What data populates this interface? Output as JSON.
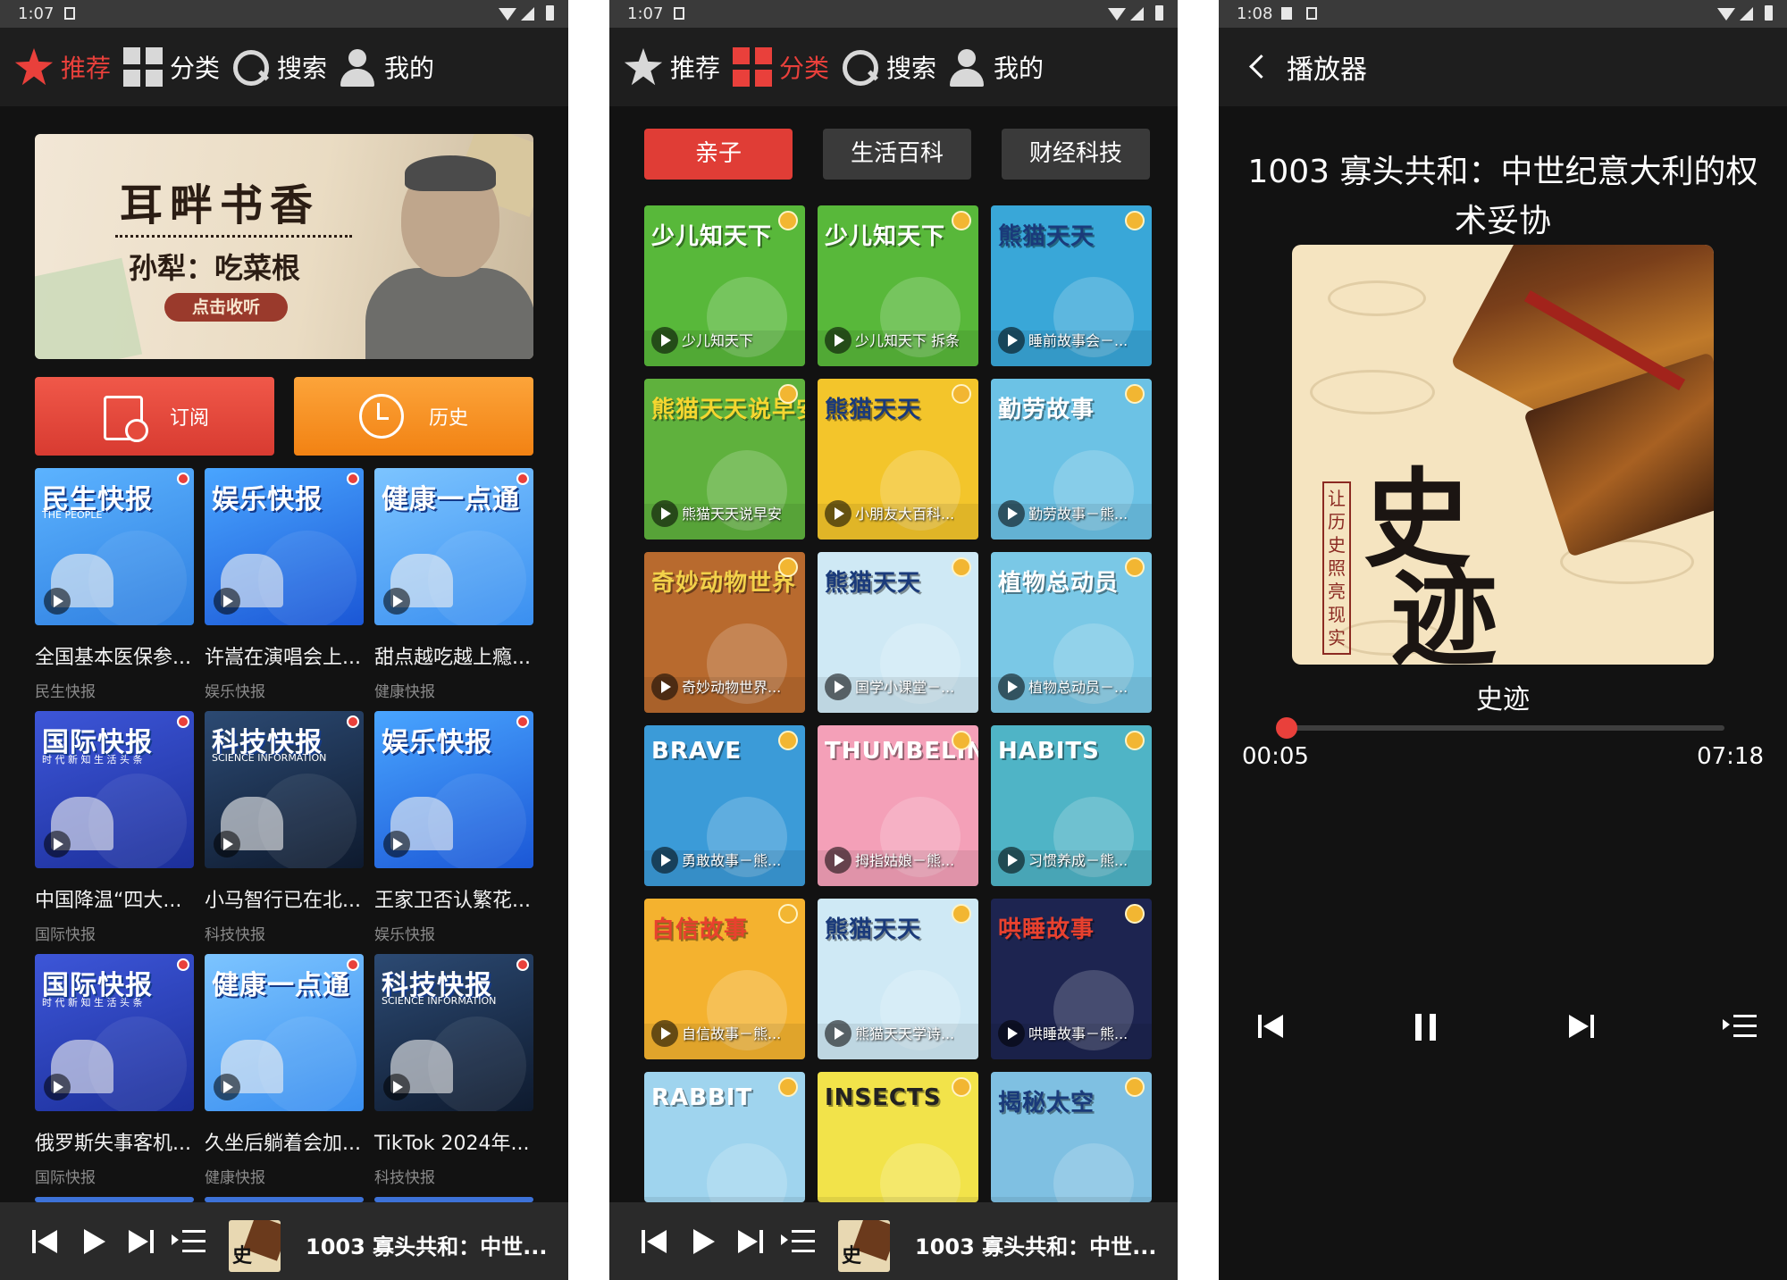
{
  "screens": {
    "home": {
      "status_time": "1:07",
      "nav": [
        "推荐",
        "分类",
        "搜索",
        "我的"
      ],
      "banner": {
        "title": "耳畔书香",
        "subtitle": "孙犁：吃菜根",
        "button": "点击收听"
      },
      "buttons": {
        "subscribe": "订阅",
        "history": "历史"
      },
      "tiles": [
        {
          "art_title": "民生快报",
          "art_sub": "THE PEOPLE",
          "caption": "全国基本医保参...",
          "tag": "民生快报"
        },
        {
          "art_title": "娱乐快报",
          "art_sub": "",
          "caption": "许嵩在演唱会上...",
          "tag": "娱乐快报"
        },
        {
          "art_title": "健康一点通",
          "art_sub": "",
          "caption": "甜点越吃越上瘾...",
          "tag": "健康快报"
        },
        {
          "art_title": "国际快报",
          "art_sub": "时 代 新 知   生 活 头 条",
          "caption": "中国降温“四大...",
          "tag": "国际快报"
        },
        {
          "art_title": "科技快报",
          "art_sub": "SCIENCE INFORMATION",
          "caption": "小马智行已在北...",
          "tag": "科技快报"
        },
        {
          "art_title": "娱乐快报",
          "art_sub": "",
          "caption": "王家卫否认繁花...",
          "tag": "娱乐快报"
        },
        {
          "art_title": "国际快报",
          "art_sub": "时 代 新 知   生 活 头 条",
          "caption": "俄罗斯失事客机...",
          "tag": "国际快报"
        },
        {
          "art_title": "健康一点通",
          "art_sub": "",
          "caption": "久坐后躺着会加...",
          "tag": "健康快报"
        },
        {
          "art_title": "科技快报",
          "art_sub": "SCIENCE INFORMATION",
          "caption": "TikTok 2024年...",
          "tag": "科技快报"
        }
      ],
      "mini_player_title": "1003 寡头共和：中世..."
    },
    "category": {
      "status_time": "1:07",
      "nav": [
        "推荐",
        "分类",
        "搜索",
        "我的"
      ],
      "categories": [
        "亲子",
        "生活百科",
        "财经科技"
      ],
      "tiles": [
        {
          "art_title": "少儿知天下",
          "label": "少儿知天下"
        },
        {
          "art_title": "少儿知天下",
          "label": "少儿知天下 拆条"
        },
        {
          "art_title": "熊猫天天",
          "label": "睡前故事会－..."
        },
        {
          "art_title": "熊猫天天说早安",
          "label": "熊猫天天说早安"
        },
        {
          "art_title": "熊猫天天",
          "label": "小朋友大百科..."
        },
        {
          "art_title": "勤劳故事",
          "label": "勤劳故事－熊..."
        },
        {
          "art_title": "奇妙动物世界",
          "label": "奇妙动物世界..."
        },
        {
          "art_title": "熊猫天天",
          "label": "国学小课堂－..."
        },
        {
          "art_title": "植物总动员",
          "label": "植物总动员－..."
        },
        {
          "art_title": "BRAVE",
          "label": "勇敢故事－熊..."
        },
        {
          "art_title": "THUMBELINA",
          "label": "拇指姑娘－熊..."
        },
        {
          "art_title": "HABITS",
          "label": "习惯养成－熊..."
        },
        {
          "art_title": "自信故事",
          "label": "自信故事－熊..."
        },
        {
          "art_title": "熊猫天天",
          "label": "熊猫天天学诗..."
        },
        {
          "art_title": "哄睡故事",
          "label": "哄睡故事－熊..."
        },
        {
          "art_title": "RABBIT",
          "label": ""
        },
        {
          "art_title": "INSECTS",
          "label": ""
        },
        {
          "art_title": "揭秘太空",
          "label": ""
        }
      ],
      "mini_player_title": "1003 寡头共和：中世..."
    },
    "player": {
      "status_time": "1:08",
      "header": "播放器",
      "title": "1003 寡头共和：中世纪意大利的权术妥协",
      "cover_text": {
        "big_top": "史",
        "big_bottom": "迹",
        "vertical": "让历史照亮现实"
      },
      "track_name": "史迹",
      "elapsed": "00:05",
      "duration": "07:18",
      "progress_fraction": 0.0115
    }
  },
  "colors": {
    "accent": "#e9403b",
    "subscribe": "#e54a3c",
    "history": "#f5901f"
  }
}
